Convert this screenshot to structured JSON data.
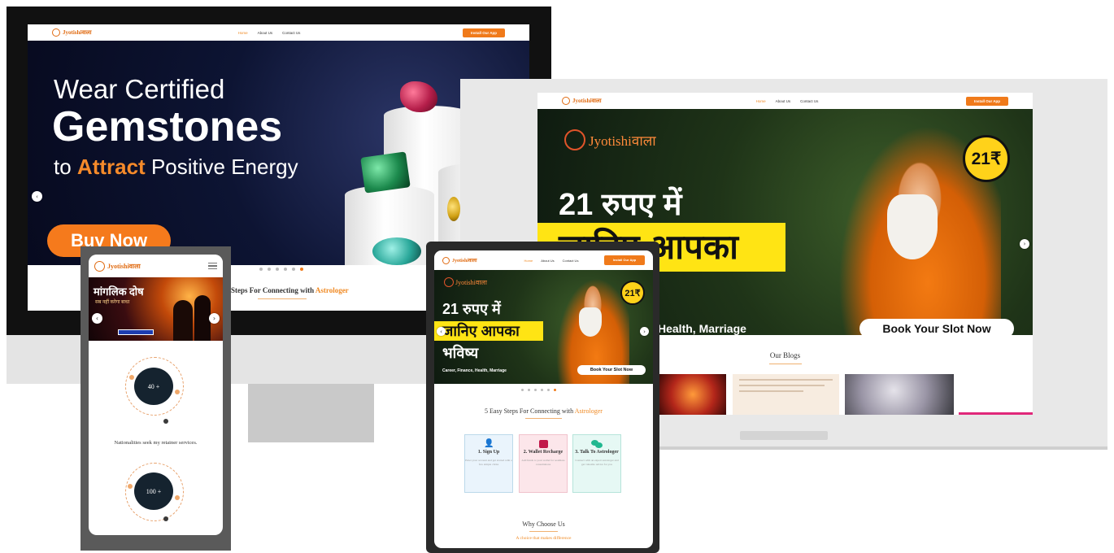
{
  "brand": {
    "name": "Jyotishiवाला",
    "accent": "#f07a1a",
    "dark_navy": "#0d1433"
  },
  "nav": {
    "home": "Home",
    "about": "About Us",
    "contact": "Contact Us",
    "cta": "Install Our App"
  },
  "desktop": {
    "hero_line1": "Wear Certified",
    "hero_line2": "Gemstones",
    "hero_line3_pre": "to",
    "hero_line3_accent": "Attract",
    "hero_line3_post": "Positive Energy",
    "buy_button": "Buy Now",
    "steps_heading_pre": "Steps For Connecting with",
    "steps_heading_accent": "Astrologer"
  },
  "monitor2": {
    "logo_text": "Jyotishiवाला",
    "price_badge": "21₹",
    "hero_line1": "21 रुपए में",
    "hero_line2": "जानिए आपका",
    "hero_line3": "Health, Marriage",
    "book_button": "Book Your Slot Now",
    "blogs_heading": "Our Blogs"
  },
  "phone": {
    "banner_title": "मांगलिक दोष",
    "banner_subtitle": "सब नहीं करेगा बाधा",
    "stat1": "40 +",
    "stat_caption": "Nationalities seek my retainer services.",
    "stat2": "100 +"
  },
  "tablet": {
    "logo_text": "Jyotishiवाला",
    "price_badge": "21₹",
    "hero_line1": "21 रुपए में",
    "hero_line2": "जानिए आपका",
    "hero_line3": "भविष्य",
    "hero_tags": "Career, Finance, Health, Marriage",
    "book_button": "Book Your Slot Now",
    "steps_heading_pre": "5 Easy Steps For Connecting with",
    "steps_heading_accent": "Astrologer",
    "steps": [
      {
        "title": "1. Sign Up",
        "desc": "Enter your account and get started with a few simple clicks"
      },
      {
        "title": "2. Wallet Recharge",
        "desc": "Add funds to your wallet for seamless consultations"
      },
      {
        "title": "3. Talk To Astrologer",
        "desc": "Connect with an expert astrologer and get valuable advice for you"
      }
    ],
    "why_heading": "Why Choose Us",
    "why_subheading": "A choice that makes difference"
  }
}
